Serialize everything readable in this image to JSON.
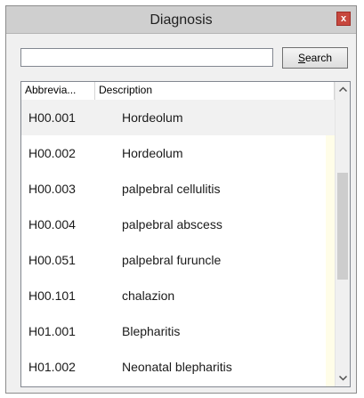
{
  "window": {
    "title": "Diagnosis",
    "close_label": "x"
  },
  "search": {
    "value": "",
    "placeholder": "",
    "button_label_first": "S",
    "button_label_rest": "earch"
  },
  "table": {
    "columns": [
      "Abbrevia...",
      "Description"
    ],
    "rows": [
      {
        "code": "H00.001",
        "description": "Hordeolum"
      },
      {
        "code": "H00.002",
        "description": "Hordeolum"
      },
      {
        "code": "H00.003",
        "description": "palpebral cellulitis"
      },
      {
        "code": "H00.004",
        "description": "palpebral abscess"
      },
      {
        "code": "H00.051",
        "description": "palpebral furuncle"
      },
      {
        "code": "H00.101",
        "description": "chalazion"
      },
      {
        "code": "H01.001",
        "description": "Blepharitis"
      },
      {
        "code": "H01.002",
        "description": "Neonatal blepharitis"
      }
    ]
  },
  "scrollbar": {
    "up_icon": "chevron-up-icon",
    "down_icon": "chevron-down-icon"
  },
  "colors": {
    "close_button": "#c7473d",
    "selected_row": "#f1f1f1",
    "titlebar": "#cfcfcf"
  }
}
